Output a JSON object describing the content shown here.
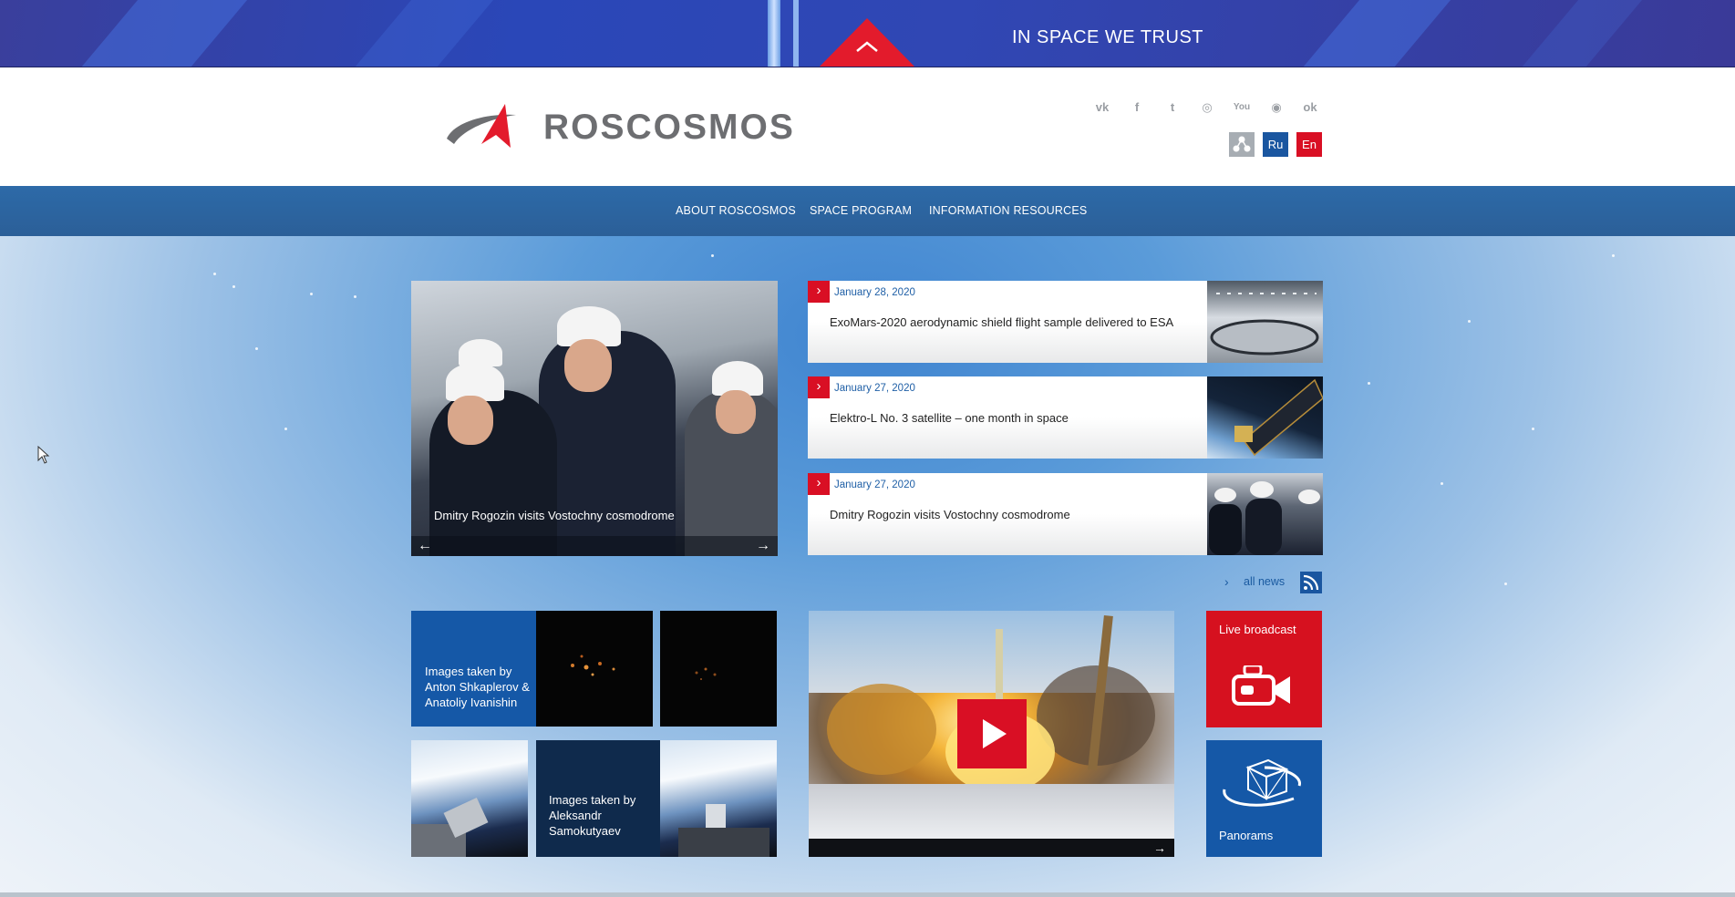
{
  "banner": {
    "slogan": "IN SPACE WE TRUST",
    "up_icon": "chevron-up-icon"
  },
  "header": {
    "logo_text": "ROSCOSMOS",
    "social_icons": [
      "vk-icon",
      "facebook-icon",
      "twitter-icon",
      "instagram-icon",
      "youtube-icon",
      "livejournal-icon",
      "odnoklassniki-icon"
    ],
    "social_glyphs": [
      "vk",
      "f",
      "t",
      "◎",
      "You",
      "◉",
      "ok"
    ],
    "languages": [
      {
        "label": "",
        "icon": "structure-icon",
        "color": "#a7adb3"
      },
      {
        "label": "Ru",
        "color": "#1a56a0"
      },
      {
        "label": "En",
        "color": "#d90f24"
      }
    ]
  },
  "nav": {
    "items": [
      "ABOUT ROSCOSMOS",
      "SPACE PROGRAM",
      "INFORMATION RESOURCES"
    ]
  },
  "slider": {
    "caption": "Dmitry Rogozin visits Vostochny cosmodrome",
    "prev": "←",
    "next": "→"
  },
  "news": [
    {
      "date": "January 28, 2020",
      "title": "ExoMars-2020 aerodynamic shield flight sample delivered to ESA",
      "flag": "›"
    },
    {
      "date": "January 27, 2020",
      "title": "Elektro-L No. 3 satellite – one month in space",
      "flag": "›"
    },
    {
      "date": "January 27, 2020",
      "title": "Dmitry Rogozin visits Vostochny cosmodrome",
      "flag": "›"
    }
  ],
  "all_news": {
    "label": "all news",
    "chevron": "›"
  },
  "tiles": {
    "gallery1": "Images taken by Anton Shkaplerov & Anatoliy Ivanishin",
    "gallery2": "Images taken by Aleksandr Samokutyaev",
    "live": "Live broadcast",
    "panorams": "Panorams"
  },
  "video": {
    "next": "→"
  },
  "colors": {
    "accent_red": "#d90f24",
    "brand_blue": "#1558a7",
    "nav_blue": "#2d6aa8",
    "navy_tile": "#0f2a4c"
  }
}
